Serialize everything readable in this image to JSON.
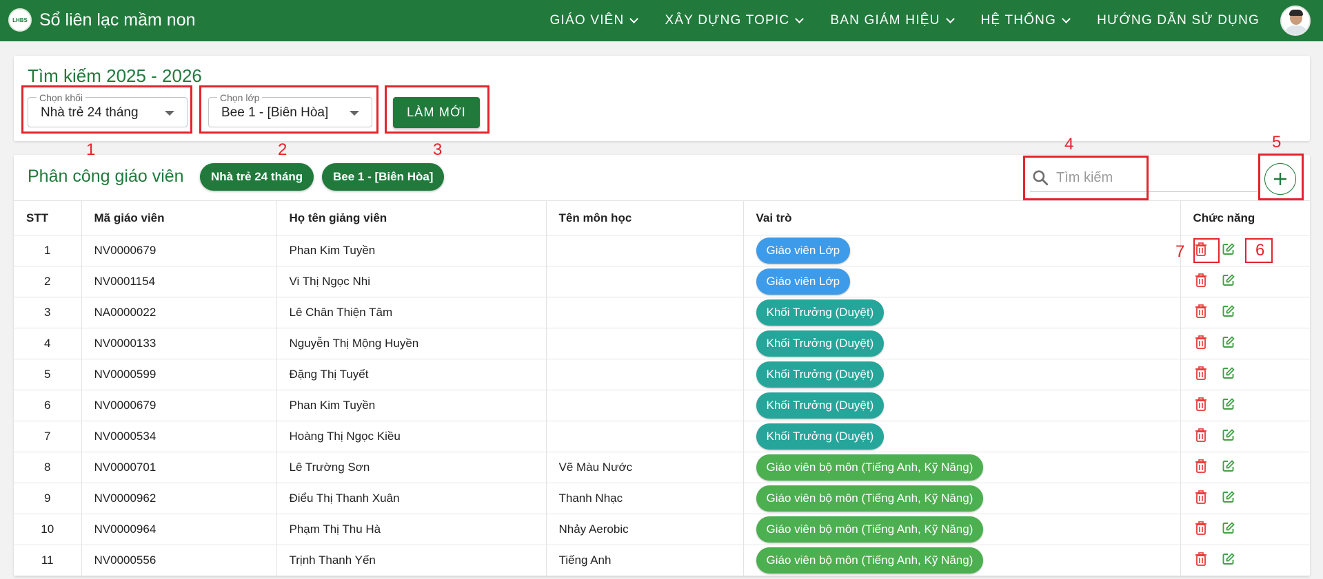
{
  "header": {
    "logo_text": "LHBS",
    "app_title": "Sổ liên lạc mầm non",
    "nav": [
      "GIÁO VIÊN",
      "XÂY DỰNG TOPIC",
      "BAN GIÁM HIỆU",
      "HỆ THỐNG",
      "HƯỚNG DẪN SỬ DỤNG"
    ],
    "brand_color": "#217a3c"
  },
  "search_panel": {
    "title": "Tìm kiếm 2025 - 2026",
    "grade_select": {
      "label": "Chọn khối",
      "value": "Nhà trẻ 24 tháng"
    },
    "class_select": {
      "label": "Chọn lớp",
      "value": "Bee 1 - [Biên Hòa]"
    },
    "reset_label": "LÀM MỚI"
  },
  "assignment": {
    "title": "Phân công giáo viên",
    "chips": [
      "Nhà trẻ 24 tháng",
      "Bee 1 - [Biên Hòa]"
    ],
    "search_placeholder": "Tìm kiếm",
    "columns": [
      "STT",
      "Mã giáo viên",
      "Họ tên giảng viên",
      "Tên môn học",
      "Vai trò",
      "Chức năng"
    ],
    "rows": [
      {
        "stt": "1",
        "code": "NV0000679",
        "name": "Phan Kim Tuyền",
        "subject": "",
        "role": "Giáo viên Lớp",
        "role_color": "#3d9be9"
      },
      {
        "stt": "2",
        "code": "NV0001154",
        "name": "Vi Thị Ngọc Nhi",
        "subject": "",
        "role": "Giáo viên Lớp",
        "role_color": "#3d9be9"
      },
      {
        "stt": "3",
        "code": "NA0000022",
        "name": "Lê Chân Thiện Tâm",
        "subject": "",
        "role": "Khối Trưởng (Duyệt)",
        "role_color": "#26a69a"
      },
      {
        "stt": "4",
        "code": "NV0000133",
        "name": "Nguyễn Thị Mộng Huyền",
        "subject": "",
        "role": "Khối Trưởng (Duyệt)",
        "role_color": "#26a69a"
      },
      {
        "stt": "5",
        "code": "NV0000599",
        "name": "Đặng Thị Tuyết",
        "subject": "",
        "role": "Khối Trưởng (Duyệt)",
        "role_color": "#26a69a"
      },
      {
        "stt": "6",
        "code": "NV0000679",
        "name": "Phan Kim Tuyền",
        "subject": "",
        "role": "Khối Trưởng (Duyệt)",
        "role_color": "#26a69a"
      },
      {
        "stt": "7",
        "code": "NV0000534",
        "name": "Hoàng Thị Ngọc Kiều",
        "subject": "",
        "role": "Khối Trưởng (Duyệt)",
        "role_color": "#26a69a"
      },
      {
        "stt": "8",
        "code": "NV0000701",
        "name": "Lê Trường Sơn",
        "subject": "Vẽ Màu Nước",
        "role": "Giáo viên bộ môn (Tiếng Anh, Kỹ Năng)",
        "role_color": "#4caf50"
      },
      {
        "stt": "9",
        "code": "NV0000962",
        "name": "Điểu Thị Thanh Xuân",
        "subject": "Thanh Nhạc",
        "role": "Giáo viên bộ môn (Tiếng Anh, Kỹ Năng)",
        "role_color": "#4caf50"
      },
      {
        "stt": "10",
        "code": "NV0000964",
        "name": "Phạm Thị Thu Hà",
        "subject": "Nhảy Aerobic",
        "role": "Giáo viên bộ môn (Tiếng Anh, Kỹ Năng)",
        "role_color": "#4caf50"
      },
      {
        "stt": "11",
        "code": "NV0000556",
        "name": "Trịnh Thanh Yến",
        "subject": "Tiếng Anh",
        "role": "Giáo viên bộ môn (Tiếng Anh, Kỹ Năng)",
        "role_color": "#4caf50"
      }
    ],
    "row_actions": [
      {
        "icon": "trash-icon",
        "color": "#e53935"
      },
      {
        "icon": "edit-icon",
        "color": "#43a047"
      }
    ]
  },
  "annotations": {
    "color": "#e3242b",
    "labels": [
      "1",
      "2",
      "3",
      "4",
      "5",
      "6",
      "7"
    ]
  }
}
